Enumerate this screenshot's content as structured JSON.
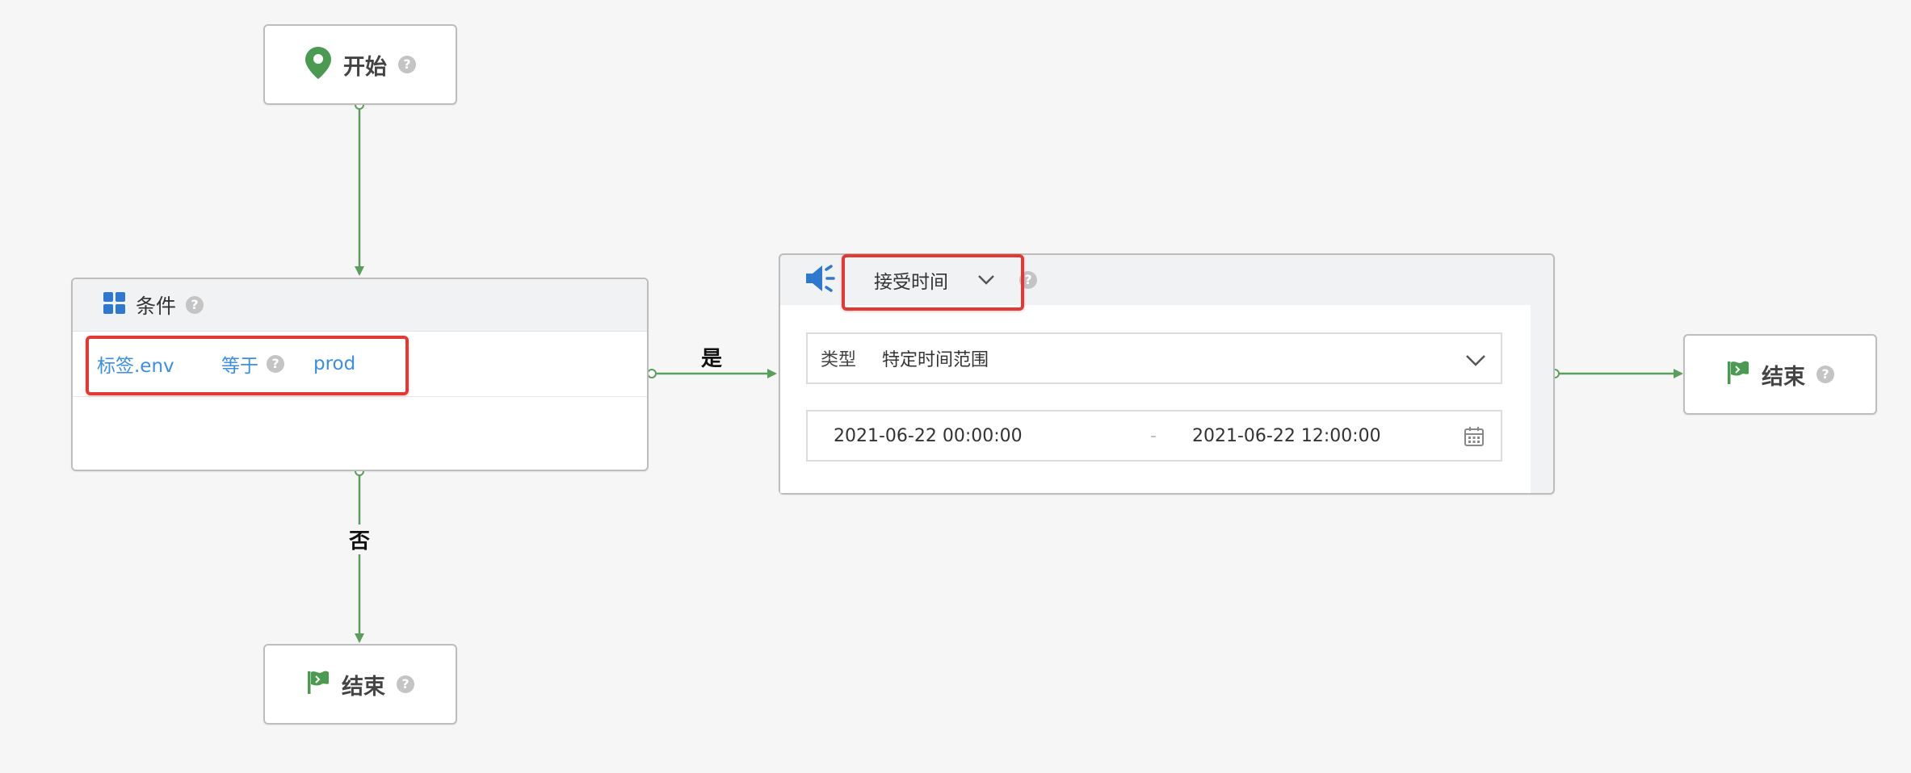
{
  "nodes": {
    "start": {
      "label": "开始"
    },
    "condition": {
      "title": "条件",
      "field": "标签.env",
      "operator": "等于",
      "value": "prod"
    },
    "action": {
      "type_select": "接受时间",
      "type_label": "类型",
      "type_value": "特定时间范围",
      "range_start": "2021-06-22 00:00:00",
      "range_separator": "-",
      "range_end": "2021-06-22 12:00:00"
    },
    "end_bottom": {
      "label": "结束"
    },
    "end_right": {
      "label": "结束"
    }
  },
  "edges": {
    "yes_label": "是",
    "no_label": "否"
  },
  "help_glyph": "?",
  "colors": {
    "edge": "#5a9e5c",
    "highlight": "#e03a35",
    "link_text": "#3a8ee6",
    "icon_blue": "#2f78d0",
    "icon_green": "#4a9b51"
  }
}
